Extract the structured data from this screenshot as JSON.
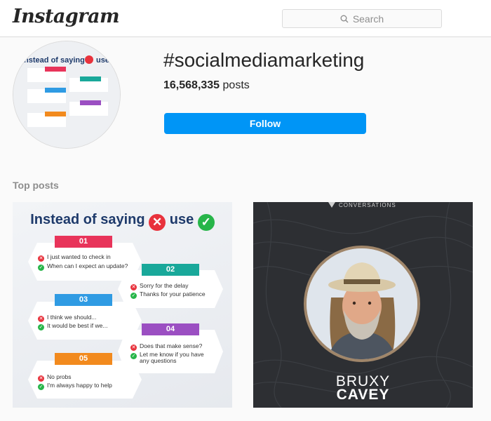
{
  "header": {
    "logo": "Instagram",
    "search_placeholder": "Search"
  },
  "hashtag": {
    "title": "#socialmediamarketing",
    "post_count": "16,568,335",
    "post_count_suffix": "posts",
    "follow_label": "Follow"
  },
  "section": {
    "top_posts_label": "Top posts"
  },
  "post1": {
    "title_prefix": "Instead of saying",
    "title_mid": "use",
    "tabs": [
      {
        "num": "01",
        "color": "#e8345a",
        "lines": [
          "I just wanted to check in",
          "When can I expect an update?"
        ]
      },
      {
        "num": "02",
        "color": "#19a89a",
        "lines": [
          "Sorry for the delay",
          "Thanks for your patience"
        ]
      },
      {
        "num": "03",
        "color": "#2f9be3",
        "lines": [
          "I think we should...",
          "It would be best if we..."
        ]
      },
      {
        "num": "04",
        "color": "#9b4fc2",
        "lines": [
          "Does that make sense?",
          "Let me know if you have",
          "any questions"
        ]
      },
      {
        "num": "05",
        "color": "#f28a1e",
        "lines": [
          "No probs",
          "I'm always happy to help"
        ]
      }
    ]
  },
  "post2": {
    "first_name": "BRUXY",
    "last_name": "CAVEY",
    "logo_text": "CONVERSATIONS"
  },
  "colors": {
    "accent": "#0095f6",
    "red_x": "#e8323c",
    "green_check": "#27b549"
  }
}
